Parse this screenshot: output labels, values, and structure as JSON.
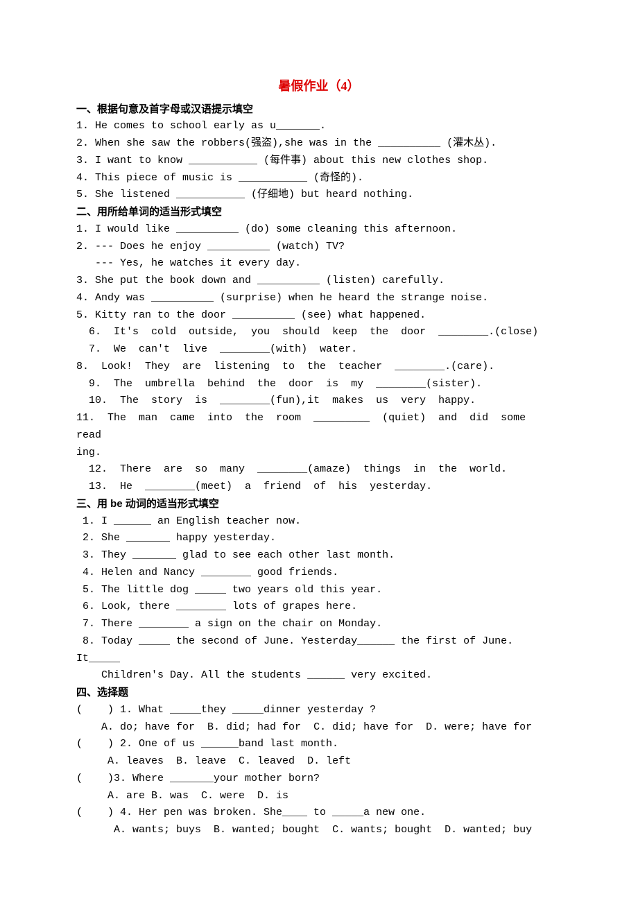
{
  "title": "暑假作业（4）",
  "s1": {
    "header": "一、根据句意及首字母或汉语提示填空",
    "q1": "1. He comes to school early as u_______.",
    "q2": "2. When she saw the robbers(强盗),she was in the __________ (灌木丛).",
    "q3": "3. I want to know ___________ (每件事) about this new clothes shop.",
    "q4": "4. This piece of music is ___________ (奇怪的).",
    "q5": "5. She listened ___________ (仔细地) but heard nothing."
  },
  "s2": {
    "header": "二、用所给单词的适当形式填空",
    "q1": "1. I would like __________ (do) some cleaning this afternoon.",
    "q2a": "2. --- Does he enjoy __________ (watch) TV?",
    "q2b": "   --- Yes, he watches it every day.",
    "q3": "3. She put the book down and __________ (listen) carefully.",
    "q4": "4. Andy was __________ (surprise) when he heard the strange noise.",
    "q5": "5. Kitty ran to the door __________ (see) what happened.",
    "q6": "  6.  It's  cold  outside,  you  should  keep  the  door  ________.(close)",
    "q7": "  7.  We  can't  live  ________(with)  water.",
    "q8": "8.  Look!  They  are  listening  to  the  teacher  ________.(care).",
    "q9": "  9.  The  umbrella  behind  the  door  is  my  ________(sister).",
    "q10": "  10.  The  story  is  ________(fun),it  makes  us  very  happy.",
    "q11a": "11.  The  man  came  into  the  room  _________  (quiet)  and  did  some  read",
    "q11b": "ing.",
    "q12": "  12.  There  are  so  many  ________(amaze)  things  in  the  world.",
    "q13": "  13.  He  ________(meet)  a  friend  of  his  yesterday."
  },
  "s3": {
    "header": "三、用 be 动词的适当形式填空",
    "q1": " 1. I ______ an English teacher now.",
    "q2": " 2. She _______ happy yesterday.",
    "q3": " 3. They _______ glad to see each other last month.",
    "q4": " 4. Helen and Nancy ________ good friends.",
    "q5": " 5. The little dog _____ two years old this year.",
    "q6": " 6. Look, there ________ lots of grapes here.",
    "q7": " 7. There ________ a sign on the chair on Monday.",
    "q8a": " 8. Today _____ the second of June. Yesterday______ the first of June. It_____",
    "q8b": "    Children's Day. All the students ______ very excited."
  },
  "s4": {
    "header": "四、选择题",
    "q1a": "(    ) 1. What _____they _____dinner yesterday ?",
    "q1b": "    A. do; have for  B. did; had for  C. did; have for  D. were; have for",
    "q2a": "(    ) 2. One of us ______band last month.",
    "q2b": "     A. leaves  B. leave  C. leaved  D. left",
    "q3a": "(    )3. Where _______your mother born?",
    "q3b": "     A. are B. was  C. were  D. is",
    "q4a": "(    ) 4. Her pen was broken. She____ to _____a new one.",
    "q4b": "      A. wants; buys  B. wanted; bought  C. wants; bought  D. wanted; buy"
  }
}
